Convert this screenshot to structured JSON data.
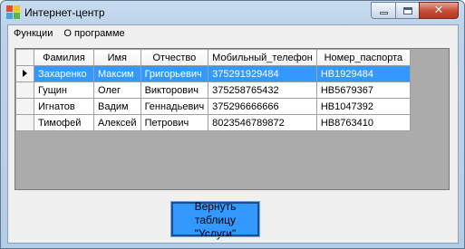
{
  "window": {
    "title": "Интернет-центр"
  },
  "menu": {
    "items": [
      "Функции",
      "О программе"
    ]
  },
  "table": {
    "columns": [
      "Фамилия",
      "Имя",
      "Отчество",
      "Мобильный_телефон",
      "Номер_паспорта"
    ],
    "rows": [
      [
        "Захаренко",
        "Максим",
        "Григорьевич",
        "375291929484",
        "HB1929484"
      ],
      [
        "Гущин",
        "Олег",
        "Викторович",
        "375258765432",
        "HB5679367"
      ],
      [
        "Игнатов",
        "Вадим",
        "Геннадьевич",
        "375296666666",
        "HB1047392"
      ],
      [
        "Тимофей",
        "Алексей",
        "Петрович",
        "8023546789872",
        "HB8763410"
      ]
    ],
    "selected_row": 0
  },
  "button": {
    "line1": "Вернуть таблицу",
    "line2": "\"Услуги\""
  },
  "colors": {
    "selection": "#3399ff",
    "button_bg": "#3399ff",
    "grid_bg": "#ababab"
  }
}
